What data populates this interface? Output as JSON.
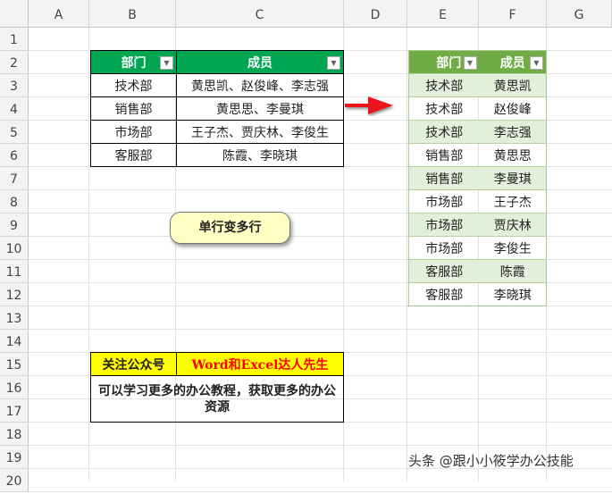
{
  "columns": [
    "A",
    "B",
    "C",
    "D",
    "E",
    "F",
    "G"
  ],
  "rows": [
    "1",
    "2",
    "3",
    "4",
    "5",
    "6",
    "7",
    "8",
    "9",
    "10",
    "11",
    "12",
    "13",
    "14",
    "15",
    "16",
    "17",
    "18",
    "19",
    "20"
  ],
  "source_table": {
    "headers": [
      "部门",
      "成员"
    ],
    "rows": [
      [
        "技术部",
        "黄思凯、赵俊峰、李志强"
      ],
      [
        "销售部",
        "黄思思、李曼琪"
      ],
      [
        "市场部",
        "王子杰、贾庆林、李俊生"
      ],
      [
        "客服部",
        "陈霞、李晓琪"
      ]
    ]
  },
  "result_table": {
    "headers": [
      "部门",
      "成员"
    ],
    "rows": [
      [
        "技术部",
        "黄思凯"
      ],
      [
        "技术部",
        "赵俊峰"
      ],
      [
        "技术部",
        "李志强"
      ],
      [
        "销售部",
        "黄思思"
      ],
      [
        "销售部",
        "李曼琪"
      ],
      [
        "市场部",
        "王子杰"
      ],
      [
        "市场部",
        "贾庆林"
      ],
      [
        "市场部",
        "李俊生"
      ],
      [
        "客服部",
        "陈霞"
      ],
      [
        "客服部",
        "李晓琪"
      ]
    ]
  },
  "button_label": "单行变多行",
  "promo": {
    "label": "关注公众号",
    "account": "Word和Excel达人先生",
    "text": "可以学习更多的办公教程，获取更多的办公资源"
  },
  "watermark": "头条 @跟小小筱学办公技能",
  "colors": {
    "green_header": "#00a651",
    "light_green_header": "#70ad47",
    "arrow": "#e8141b",
    "promo_bg": "#ffff00",
    "promo_red": "#ff0000"
  }
}
